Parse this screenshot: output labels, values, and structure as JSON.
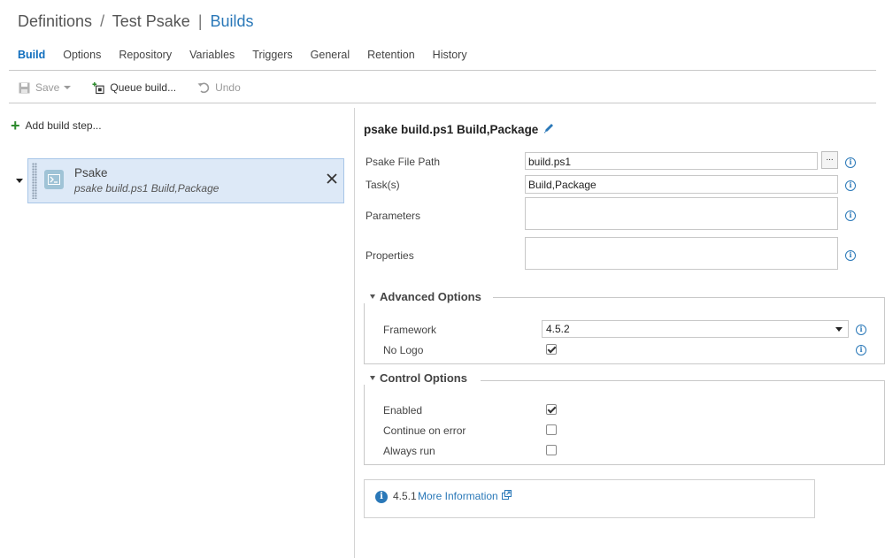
{
  "breadcrumb": {
    "part1": "Definitions",
    "sep1": "/",
    "part2": "Test Psake",
    "sep2": "|",
    "part3": "Builds"
  },
  "tabs": [
    {
      "label": "Build",
      "active": true
    },
    {
      "label": "Options"
    },
    {
      "label": "Repository"
    },
    {
      "label": "Variables"
    },
    {
      "label": "Triggers"
    },
    {
      "label": "General"
    },
    {
      "label": "Retention"
    },
    {
      "label": "History"
    }
  ],
  "toolbar": {
    "save_label": "Save",
    "queue_label": "Queue build...",
    "undo_label": "Undo"
  },
  "left": {
    "add_step_label": "Add build step...",
    "step": {
      "title": "Psake",
      "subtitle": "psake build.ps1 Build,Package"
    }
  },
  "task": {
    "title": "psake build.ps1 Build,Package",
    "fields": {
      "psake_file_path_label": "Psake File Path",
      "psake_file_path_value": "build.ps1",
      "browse_label": "...",
      "tasks_label": "Task(s)",
      "tasks_value": "Build,Package",
      "parameters_label": "Parameters",
      "parameters_value": "",
      "properties_label": "Properties",
      "properties_value": ""
    },
    "advanced": {
      "heading": "Advanced Options",
      "framework_label": "Framework",
      "framework_value": "4.5.2",
      "no_logo_label": "No Logo",
      "no_logo_checked": true
    },
    "control": {
      "heading": "Control Options",
      "enabled_label": "Enabled",
      "enabled_checked": true,
      "continue_label": "Continue on error",
      "continue_checked": false,
      "always_label": "Always run",
      "always_checked": false
    },
    "info": {
      "version": "4.5.1",
      "more_label": "More Information"
    }
  },
  "colors": {
    "accent": "#106ebe",
    "link": "#2a78b8",
    "step_bg": "#dde9f7",
    "add_green": "#2e8b2e"
  },
  "icons": [
    "save-icon",
    "queue-build-icon",
    "undo-icon",
    "plus-icon",
    "powershell-icon",
    "close-icon",
    "pencil-icon",
    "info-icon",
    "external-link-icon"
  ]
}
